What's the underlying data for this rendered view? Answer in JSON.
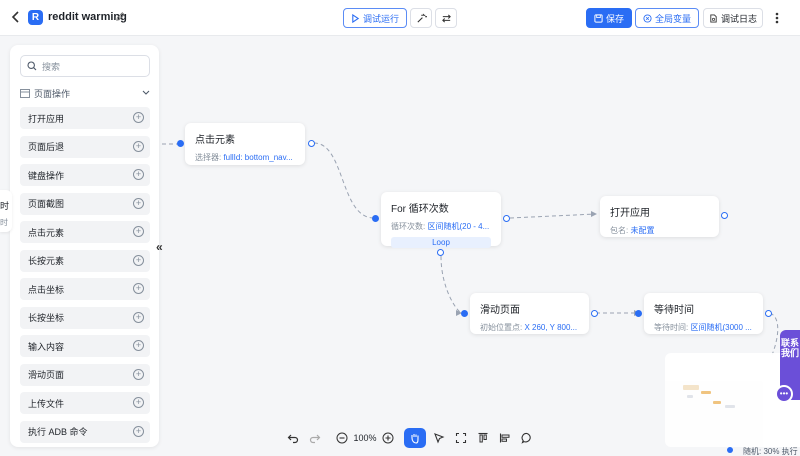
{
  "header": {
    "logo_letter": "R",
    "title": "reddit warming",
    "debug_run_label": "调试运行",
    "save_label": "保存",
    "global_vars_label": "全局变量",
    "debug_log_label": "调试日志"
  },
  "sidebar": {
    "search_placeholder": "搜索",
    "section_label": "页面操作",
    "items": [
      {
        "label": "打开应用"
      },
      {
        "label": "页面后退"
      },
      {
        "label": "键盘操作"
      },
      {
        "label": "页面截图"
      },
      {
        "label": "点击元素"
      },
      {
        "label": "长按元素"
      },
      {
        "label": "点击坐标"
      },
      {
        "label": "长按坐标"
      },
      {
        "label": "输入内容"
      },
      {
        "label": "滑动页面"
      },
      {
        "label": "上传文件"
      },
      {
        "label": "执行 ADB 命令"
      }
    ],
    "collapse_label": "«"
  },
  "partial_node": {
    "line1": "时",
    "line2": "时"
  },
  "nodes": {
    "click_element": {
      "title": "点击元素",
      "sub_key": "选择器: ",
      "sub_val": "fullId: bottom_nav..."
    },
    "for_loop": {
      "title": "For 循环次数",
      "sub_key": "循环次数: ",
      "sub_val": "区间随机(20 - 4...",
      "tag": "Loop"
    },
    "open_app": {
      "title": "打开应用",
      "sub_key": "包名: ",
      "sub_val": "未配置"
    },
    "swipe": {
      "title": "滑动页面",
      "sub_key": "初始位置点: ",
      "sub_val": "X 260, Y 800..."
    },
    "wait": {
      "title": "等待时间",
      "sub_key": "等待时间: ",
      "sub_val": "区间随机(3000 ..."
    }
  },
  "bottom_toolbar": {
    "zoom": "100%"
  },
  "contact": {
    "label": "联系我们"
  },
  "status": {
    "text": "随机: 30%  执行"
  }
}
